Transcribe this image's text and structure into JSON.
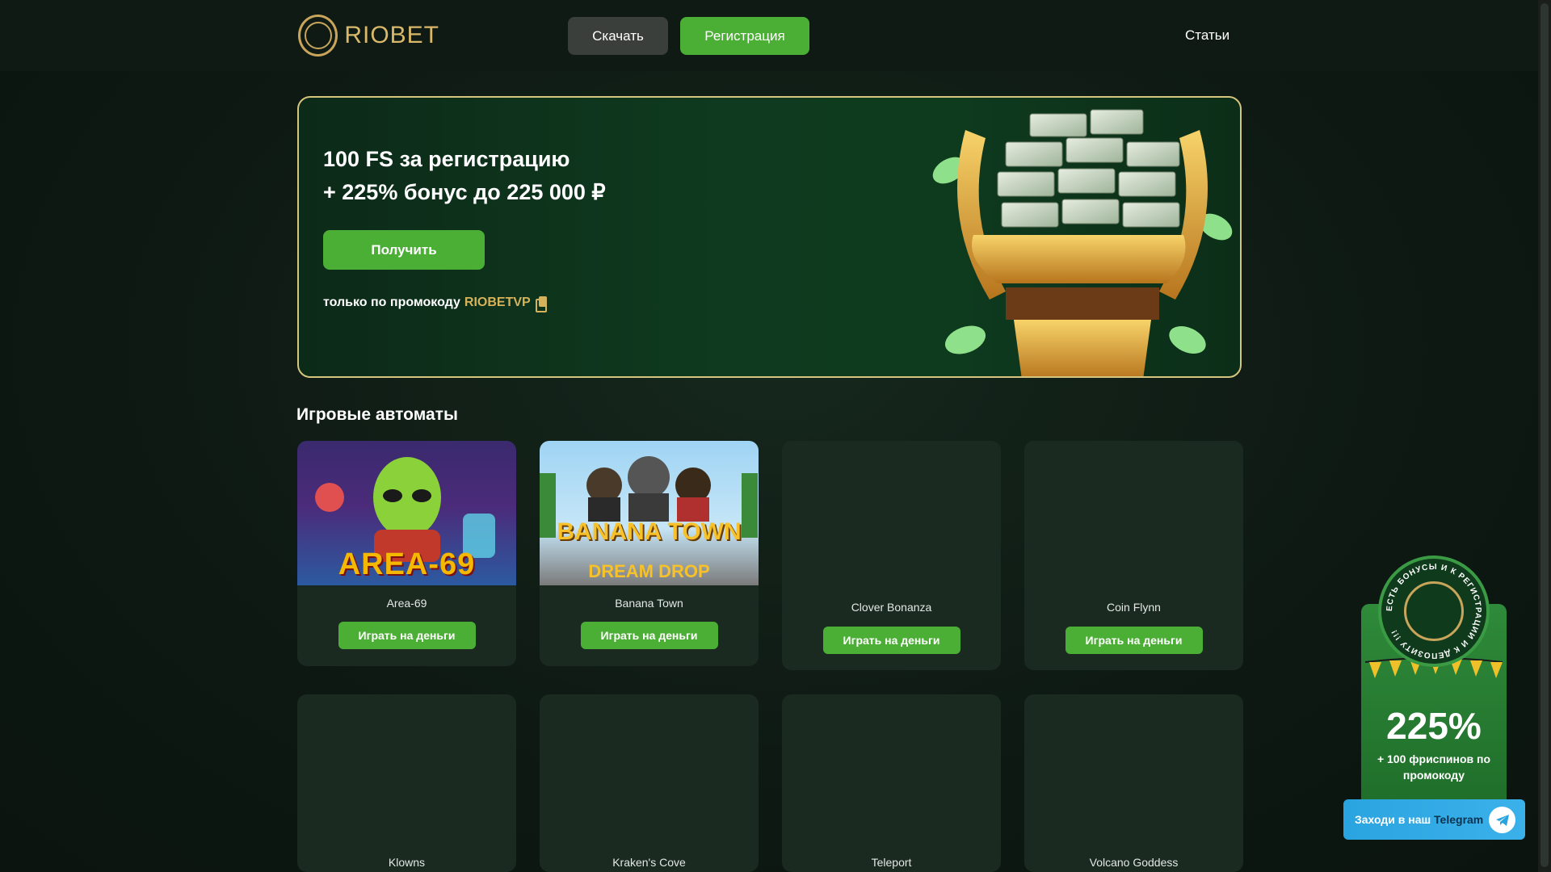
{
  "header": {
    "logo_text": "RIOBET",
    "download_label": "Скачать",
    "register_label": "Регистрация",
    "articles_label": "Статьи"
  },
  "banner": {
    "title_line1": "100 FS за регистрацию",
    "title_line2": "+ 225% бонус до 225 000 ₽",
    "get_label": "Получить",
    "promo_prefix": "только по промокоду",
    "promo_code": "RIOBETVP"
  },
  "section": {
    "title": "Игровые автоматы"
  },
  "games": [
    {
      "name": "Area-69",
      "play_label": "Играть на деньги",
      "image_text": "AREA-69"
    },
    {
      "name": "Banana Town",
      "play_label": "Играть на деньги",
      "image_text": "BANANA TOWN",
      "image_sub": "DREAM DROP"
    },
    {
      "name": "Clover Bonanza",
      "play_label": "Играть на деньги"
    },
    {
      "name": "Coin Flynn",
      "play_label": "Играть на деньги"
    },
    {
      "name": "Klowns"
    },
    {
      "name": "Kraken's Cove"
    },
    {
      "name": "Teleport"
    },
    {
      "name": "Volcano Goddess"
    }
  ],
  "side_promo": {
    "badge_text": "ЕСТЬ БОНУСЫ И К РЕГИСТРАЦИИ И К ДЕПОЗИТУ !!!",
    "percent": "225%",
    "text": "+ 100 фриспинов по промокоду",
    "telegram_prefix": "Заходи в наш",
    "telegram_brand": "Telegram"
  },
  "colors": {
    "accent_green": "#4caf35",
    "gold": "#d6b25a",
    "telegram_blue": "#2aa4e0"
  }
}
